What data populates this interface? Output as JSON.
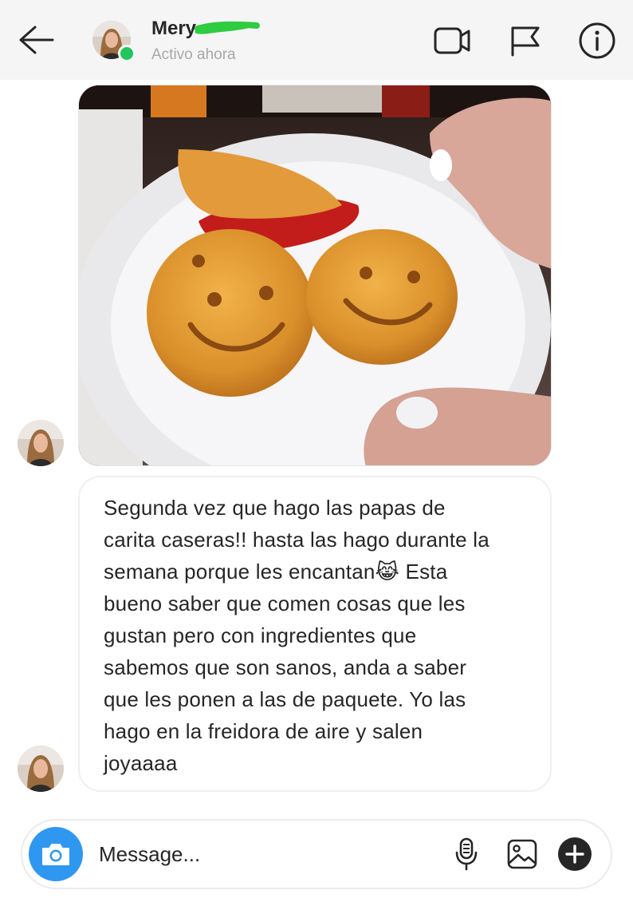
{
  "header": {
    "contact_name": "Mery",
    "status": "Activo ahora",
    "back_icon": "arrow-left-icon",
    "video_call_icon": "video-camera-icon",
    "report_icon": "flag-icon",
    "info_icon": "info-icon",
    "online_color": "#22c55e"
  },
  "messages": [
    {
      "type": "image",
      "description_icon": "photo-smiley-potato-fries"
    },
    {
      "type": "text",
      "lines": [
        "Segunda vez que hago las papas de",
        "carita caseras!! hasta las hago durante la",
        "semana porque les encantan😹 Esta",
        "bueno saber que comen cosas que les",
        "gustan pero con ingredientes que",
        "sabemos que son sanos, anda a saber",
        "que les ponen a las de paquete. Yo las",
        "hago en la freidora de aire y salen",
        "joyaaaa"
      ]
    }
  ],
  "composer": {
    "placeholder": "Message...",
    "camera_icon": "camera-icon",
    "mic_icon": "microphone-icon",
    "gallery_icon": "image-gallery-icon",
    "add_icon": "plus-circle-icon",
    "accent": "#2f97f0"
  }
}
